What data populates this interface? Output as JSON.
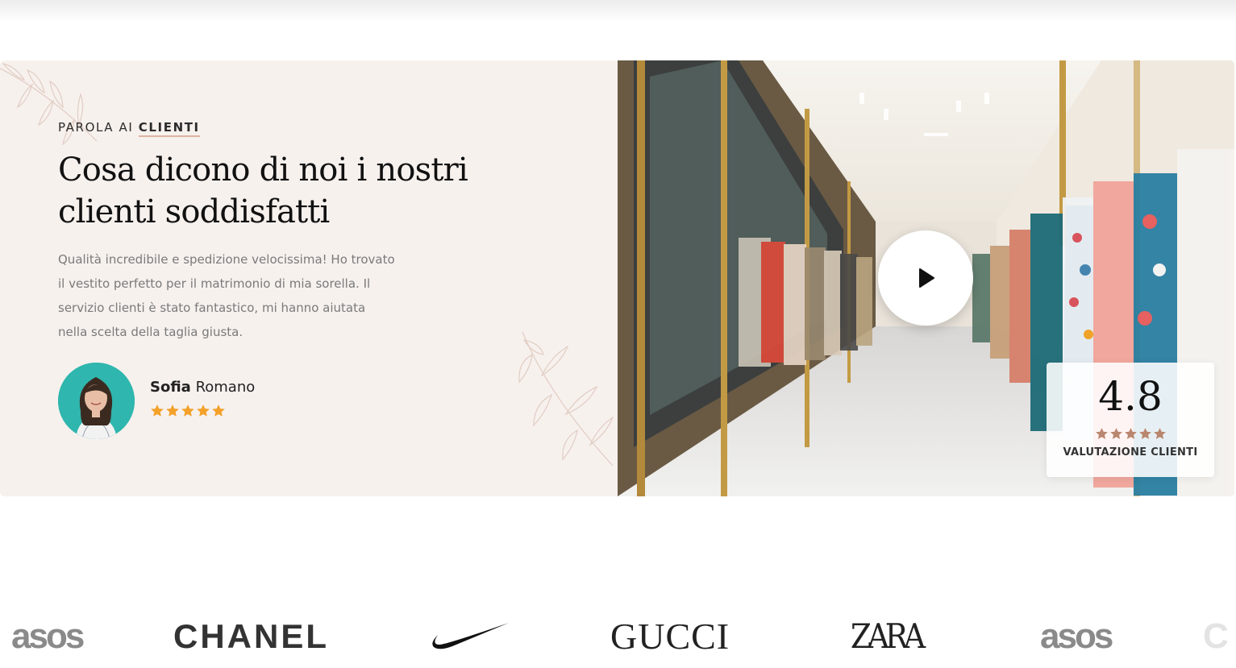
{
  "testimonial": {
    "eyebrow_prefix": "PAROLA AI",
    "eyebrow_accent": "CLIENTI",
    "heading_line1": "Cosa dicono di noi i nostri",
    "heading_line2": "clienti soddisfatti",
    "quote_lines": [
      "Qualità incredibile e spedizione velocissima! Ho trovato",
      "il vestito perfetto per il matrimonio di mia sorella. Il",
      "servizio clienti è stato fantastico, mi hanno aiutata",
      "nella scelta della taglia giusta."
    ],
    "author_first": "Sofia",
    "author_last": "Romano",
    "author_stars": 5,
    "star_color": "#f3a12a"
  },
  "video": {
    "play_icon": "play-icon",
    "rating_value": "4.8",
    "rating_stars": 5,
    "rating_star_color": "#b9866e",
    "rating_label": "VALUTAZIONE CLIENTI"
  },
  "brands": [
    "asos",
    "CHANEL",
    "nike",
    "GUCCI",
    "ZARA",
    "asos"
  ],
  "colors": {
    "panel_bg": "#f7f1ee",
    "accent_underline": "#dcb3a1"
  }
}
